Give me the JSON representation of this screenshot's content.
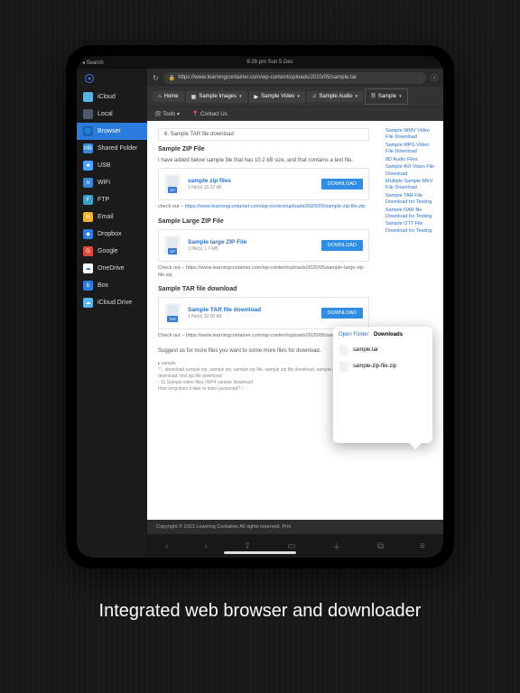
{
  "status": {
    "back": "◂ Search",
    "time": "6:26 pm   Sun 5 Dec"
  },
  "sidebar": {
    "groups": [
      "iCloud",
      "Local"
    ],
    "selected": "Browser",
    "items": [
      {
        "label": "Shared Folder",
        "color": "#3a87d6",
        "glyph": "MB"
      },
      {
        "label": "USB",
        "color": "#4aa3ff",
        "glyph": "■"
      },
      {
        "label": "WiFi",
        "color": "#3a87d6",
        "glyph": "≋"
      },
      {
        "label": "FTP",
        "color": "#3aa0c9",
        "glyph": "F"
      },
      {
        "label": "Email",
        "color": "#f2b233",
        "glyph": "✉"
      },
      {
        "label": "Dropbox",
        "color": "#2b7de0",
        "glyph": "◆"
      },
      {
        "label": "Google",
        "color": "#e04a3a",
        "glyph": "G"
      },
      {
        "label": "OneDrive",
        "color": "#ffffff",
        "glyph": "☁"
      },
      {
        "label": "Box",
        "color": "#2b7de0",
        "glyph": "b"
      },
      {
        "label": "iCloud Drive",
        "color": "#59b7e8",
        "glyph": "☁"
      }
    ]
  },
  "address": {
    "url": "https://www.learningcontainer.com/wp-content/uploads/2020/05/sample.tar"
  },
  "nav": {
    "home": "Home",
    "images": "Sample Images",
    "video": "Sample Video",
    "audio": "Sample Audio",
    "sample": "Sample",
    "tools": "Tools",
    "contact": "Contact Us"
  },
  "article": {
    "breadcrumb": "6. Sample TAR file download",
    "h1": "Sample ZIP File",
    "p1": "I have added below sample file that has 10.2 kB size, and that contains a text file.",
    "card1": {
      "name": "sample zip files",
      "meta": "1 file(s)   10.37 kB",
      "btn": "DOWNLOAD",
      "tag": "ZIP"
    },
    "check1a": "check out – ",
    "check1b": "https://www.learningcontainer.com/wp-content/uploads/2020/05/sample-zip-file.zip",
    "h2": "Sample Large ZIP File",
    "card2": {
      "name": "Sample large ZIP File",
      "meta": "1 file(s)   1.7 MB",
      "btn": "DOWNLOAD",
      "tag": "ZIP"
    },
    "check2": "Check out – https://www.learningcontainer.com/wp-content/uploads/2020/05/sample-large-zip-file.zip",
    "h3": "Sample TAR file download",
    "card3": {
      "name": "Sample TAR file download",
      "meta": "1 file(s)   10.00 kB",
      "btn": "DOWNLOAD",
      "tag": "TAR"
    },
    "check3": "Check out – https://www.learningcontainer.com/wp-content/uploads/2020/05/sample.tar",
    "suggest": "Suggest us for more files you want to some more files for download.",
    "cat": "sample",
    "tagline1": "download sample zip, sample zip, sample zip file, sample zip file download, sample zip file free download, test zip file download",
    "tagline2": "11 Sample video files | MP4 sample download",
    "tagline3": "How long does it take to learn javascript?"
  },
  "footer": "Copyright © 2021 Learning Container All rights reserved.     Priv",
  "sidelinks": [
    "Sample WMV Video File Download",
    "Sample MPG Video File Download",
    "8D Audio Files",
    "Sample AVI Video File Download",
    "Multiple Sample MKV File Download",
    "Sample TAR File Download for Testing",
    "Sample RAR file Download for Testing",
    "Sample OTT File Download for Testing"
  ],
  "popup": {
    "open": "Open Folder",
    "title": "Downloads",
    "files": [
      "sample.tar",
      "sample-zip-file.zip"
    ]
  },
  "caption": "Integrated web browser and downloader"
}
